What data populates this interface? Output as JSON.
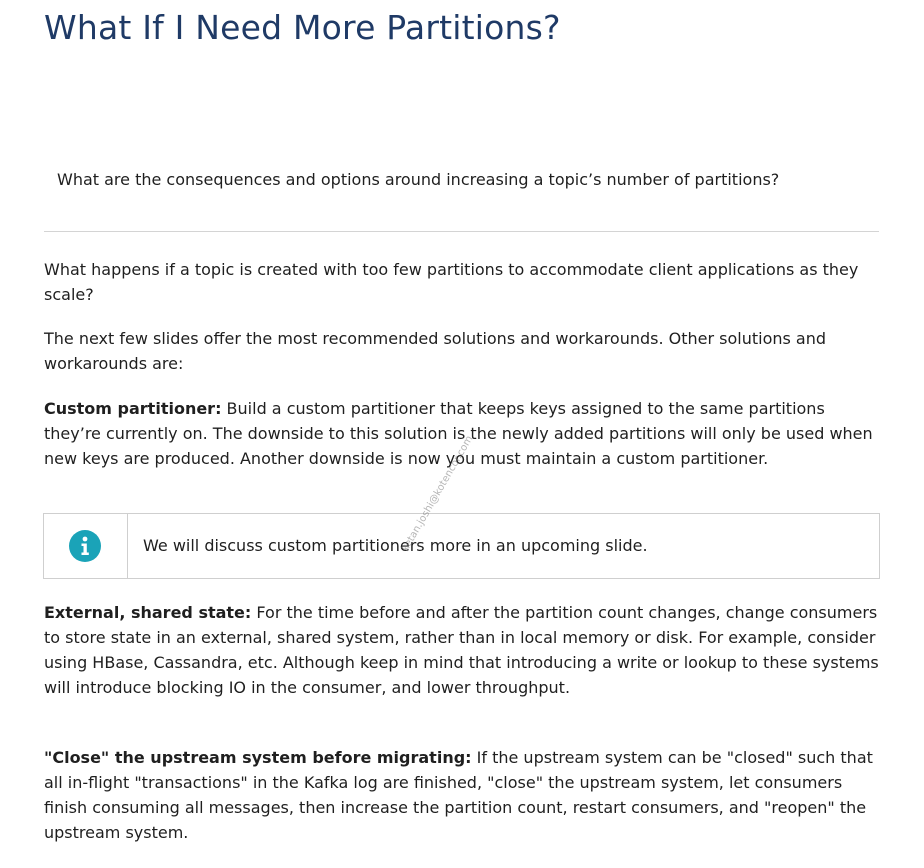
{
  "title": "What If I Need More Partitions?",
  "question": "What are the consequences and options around increasing a topic’s number of partitions?",
  "paragraphs": {
    "p1": "What happens if a topic is created with too few partitions to accommodate client applications as they scale?",
    "p2": "The next few slides offer the most recommended solutions and workarounds. Other solutions and workarounds are:",
    "p3_label": "Custom partitioner:",
    "p3_text": " Build a custom partitioner that keeps keys assigned to the same partitions they’re currently on. The downside to this solution is the newly added partitions will only be used when new keys are produced. Another downside is now you must maintain a custom partitioner.",
    "p4_label": "External, shared state:",
    "p4_text": " For the time before and after the partition count changes, change consumers to store state in an external, shared system, rather than in local memory or disk. For example, consider using HBase, Cassandra, etc. Although keep in mind that introducing a write or lookup to these systems will introduce blocking IO in the consumer, and lower throughput.",
    "p5_label": "\"Close\" the upstream system before migrating:",
    "p5_text": " If the upstream system can be \"closed\" such that all in-flight \"transactions\" in the Kafka log are finished, \"close\" the upstream system, let consumers finish consuming all messages, then increase the partition count, restart consumers, and \"reopen\" the upstream system."
  },
  "note": {
    "icon": "info-icon",
    "icon_color": "#1aa3b8",
    "text": "We will discuss custom partitioners more in an upcoming slide."
  },
  "watermark": "ketan.joshi@kotencor.com",
  "colors": {
    "title": "#1f3a66",
    "rule": "#d4d4d4"
  }
}
